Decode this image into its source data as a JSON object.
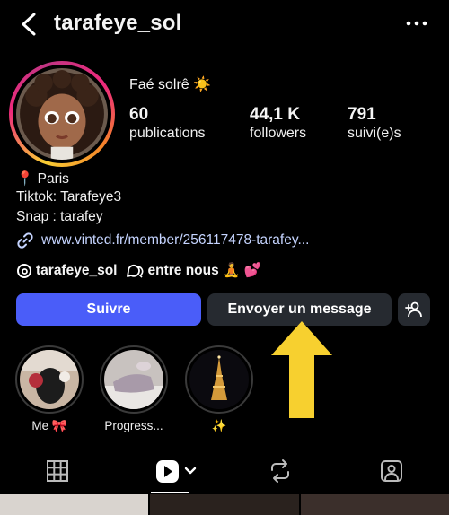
{
  "header": {
    "username": "tarafeye_sol"
  },
  "profile": {
    "display_name": "Faé solrê ☀️",
    "stats": [
      {
        "value": "60",
        "label": "publications"
      },
      {
        "value": "44,1 K",
        "label": "followers"
      },
      {
        "value": "791",
        "label": "suivi(e)s"
      }
    ],
    "bio": [
      "📍 Paris",
      "Tiktok: Tarafeye3",
      "Snap : tarafey"
    ],
    "link": "www.vinted.fr/member/256117478-tarafey...",
    "threads_handle": "tarafeye_sol",
    "group_name": "entre nous 🧘 💕"
  },
  "actions": {
    "follow": "Suivre",
    "message": "Envoyer un message"
  },
  "highlights": [
    {
      "label": "Me 🎀"
    },
    {
      "label": "Progress..."
    },
    {
      "label": "✨"
    }
  ],
  "colors": {
    "follow_button": "#4a5df9",
    "secondary_button": "#262a30",
    "link": "#c5d4ff",
    "arrow": "#f7d02f"
  }
}
